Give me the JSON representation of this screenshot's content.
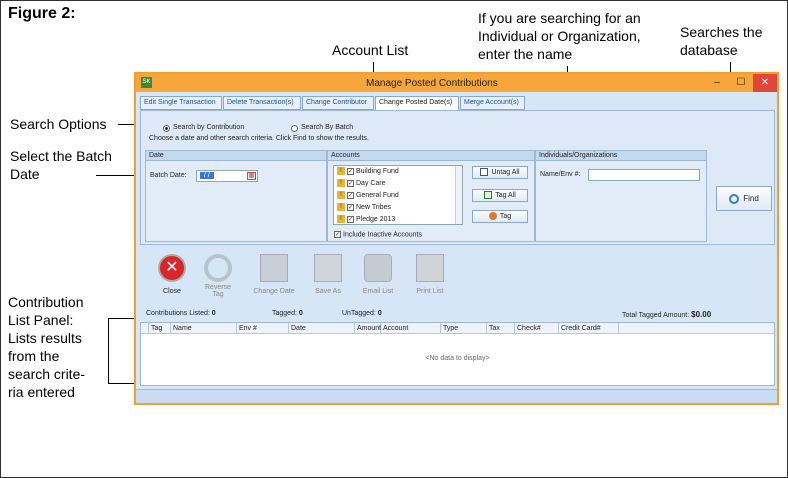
{
  "figure_title": "Figure 2:",
  "callouts": {
    "search_options": "Search Options",
    "batch_date_l1": "Select the Batch",
    "batch_date_l2": "Date",
    "account_list": "Account List",
    "individual_l1": "If you are searching for an",
    "individual_l2": "Individual or Organization,",
    "individual_l3": "enter the name",
    "searches_l1": "Searches the",
    "searches_l2": "database",
    "panel_l1": "Contribution",
    "panel_l2": "List Panel:",
    "panel_l3": "Lists results",
    "panel_l4": "from the",
    "panel_l5": "search crite-",
    "panel_l6": "ria entered"
  },
  "window": {
    "app_icon": "SK",
    "title": "Manage Posted Contributions",
    "min_glyph": "–",
    "max_glyph": "☐",
    "close_glyph": "✕"
  },
  "tabs": [
    {
      "label": "Edit Single Transaction"
    },
    {
      "label": "Delete Transaction(s)"
    },
    {
      "label": "Change Contributor"
    },
    {
      "label": "Change Posted Date(s)"
    },
    {
      "label": "Merge Account(s)"
    }
  ],
  "search": {
    "by_contribution": "Search by Contribution",
    "by_batch": "Search By Batch",
    "instructions": "Choose a date and other search criteria. Click Find to show the results."
  },
  "date_group": {
    "header": "Date",
    "label": "Batch Date:",
    "value": "/ /"
  },
  "accounts_group": {
    "header": "Accounts",
    "items": [
      "Building Fund",
      "Day Care",
      "General Fund",
      "New Tribes",
      "Pledge 2013"
    ],
    "include_inactive": "Include Inactive Accounts",
    "untag_all": "Untag All",
    "tag_all": "Tag All",
    "tag": "Tag"
  },
  "individuals_group": {
    "header": "Individuals/Organizations",
    "name_label": "Name/Env #:"
  },
  "find_label": "Find",
  "toolbar": {
    "close": "Close",
    "reverse_l1": "Reverse",
    "reverse_l2": "Tag",
    "change_date": "Change Date",
    "save_as": "Save As",
    "email_list": "Email List",
    "print_list": "Print List"
  },
  "stats": {
    "listed_label": "Contributions Listed:",
    "listed_value": "0",
    "tagged_label": "Tagged:",
    "tagged_value": "0",
    "untagged_label": "UnTagged:",
    "untagged_value": "0",
    "total_label": "Total Tagged Amount:",
    "total_value": "$0.00"
  },
  "grid": {
    "columns": [
      "Tag",
      "Name",
      "Env #",
      "Date",
      "Amount",
      "Account",
      "Type",
      "Tax",
      "Check#",
      "Credit Card#"
    ],
    "empty_text": "<No data to display>"
  },
  "colors": {
    "titlebar": "#f6a63a",
    "window_border": "#f0a030",
    "panel_bg": "#dde9f6",
    "close_red": "#e0463a"
  }
}
